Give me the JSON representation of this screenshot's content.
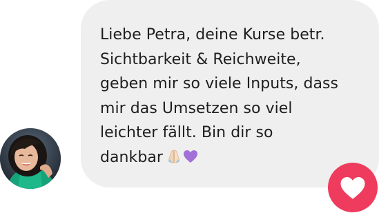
{
  "message": {
    "lines": [
      "Liebe Petra, deine Kurse betr.",
      "Sichtbarkeit & Reichweite,",
      "geben mir so viele Inputs, dass",
      "mir das Umsetzen so viel",
      "leichter fällt. Bin dir so",
      "dankbar"
    ],
    "emojis": [
      "folded-hands-emoji",
      "purple-heart-emoji"
    ]
  },
  "avatar": {
    "icon": "user-photo"
  },
  "reaction": {
    "icon": "heart-icon",
    "color": "#ef3b5d"
  },
  "colors": {
    "bubble": "#efefef",
    "text": "#1e1e1e",
    "accent": "#ef3b5d"
  }
}
